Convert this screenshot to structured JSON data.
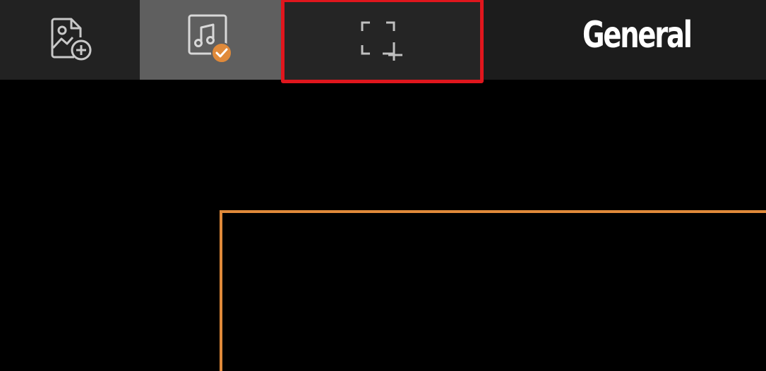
{
  "header": {
    "title": "General"
  },
  "toolbar": {
    "buttons": [
      {
        "id": "add-image",
        "icon": "image-add-icon",
        "selected": false
      },
      {
        "id": "add-audio",
        "icon": "music-file-icon",
        "selected": true,
        "badge_icon": "check-badge-icon"
      },
      {
        "id": "add-region",
        "icon": "crop-add-icon",
        "selected": false,
        "highlighted": true
      }
    ]
  },
  "colors": {
    "accent": "#e08a3a",
    "highlight": "#e0161d",
    "toolbar_bg": "#1f1f1f",
    "selected_bg": "#5f5f5f",
    "icon": "#c8c8c8"
  }
}
